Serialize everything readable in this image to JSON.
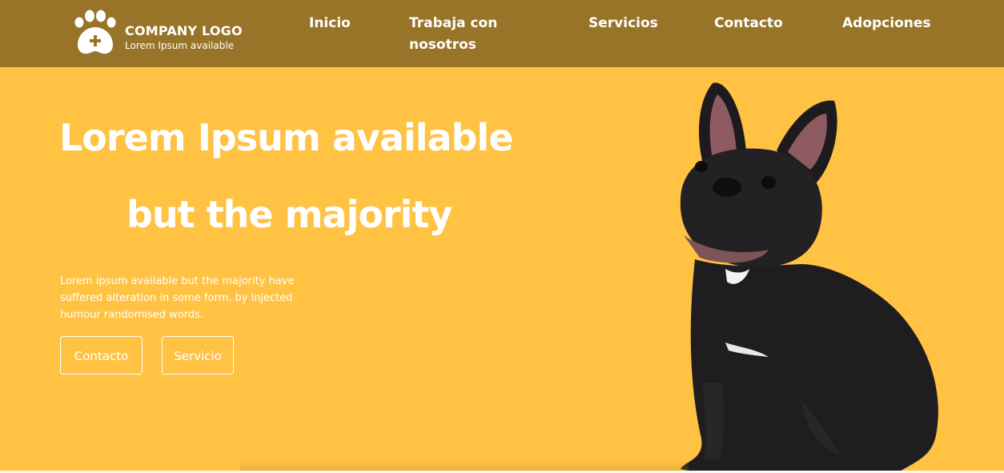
{
  "header": {
    "logo": {
      "title": "COMPANY LOGO",
      "subtitle": "Lorem Ipsum available",
      "icon": "paw-plus-icon"
    },
    "nav": [
      {
        "label": "Inicio"
      },
      {
        "label": "Trabaja con nosotros"
      },
      {
        "label": "Servicios"
      },
      {
        "label": "Contacto"
      },
      {
        "label": "Adopciones"
      }
    ]
  },
  "hero": {
    "title_line1": "Lorem Ipsum available",
    "title_line2": "but the majority",
    "description": "Lorem ipsum available but the majority have suffered alteration in some form, by injected humour randomised words.",
    "buttons": [
      {
        "label": "Contacto"
      },
      {
        "label": "Servicio"
      }
    ],
    "image": "french-bulldog-photo"
  },
  "colors": {
    "navbar": "#987428",
    "hero_background": "#FFC243",
    "text": "#FFFFFF"
  }
}
